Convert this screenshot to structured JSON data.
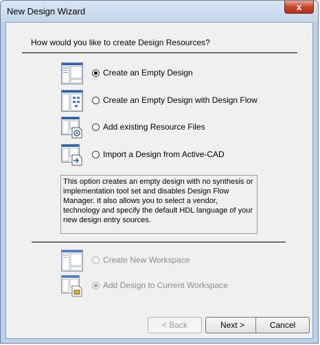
{
  "window": {
    "title": "New Design Wizard",
    "close_glyph": "x"
  },
  "question": "How would you like to create Design Resources?",
  "options": [
    {
      "label": "Create an Empty Design",
      "selected": true,
      "icon": "empty-design-icon"
    },
    {
      "label": "Create an Empty Design with Design Flow",
      "selected": false,
      "icon": "design-flow-icon"
    },
    {
      "label": "Add existing Resource Files",
      "selected": false,
      "icon": "resource-files-icon"
    },
    {
      "label": "Import a Design from Active-CAD",
      "selected": false,
      "icon": "import-design-icon"
    }
  ],
  "description": "This option creates an empty design with no synthesis or implementation tool set and disables Design Flow Manager. It also allows you to select a vendor, technology and specify the default HDL language of your new design entry sources.",
  "workspace_options": [
    {
      "label": "Create New Workspace",
      "selected": false,
      "enabled": false
    },
    {
      "label": "Add Design to Current Workspace",
      "selected": true,
      "enabled": false
    }
  ],
  "buttons": {
    "back": "< Back",
    "next": "Next >",
    "cancel": "Cancel"
  },
  "colors": {
    "frame": "#b9d1ea",
    "client": "#f0f0f0",
    "close": "#c7452c"
  }
}
